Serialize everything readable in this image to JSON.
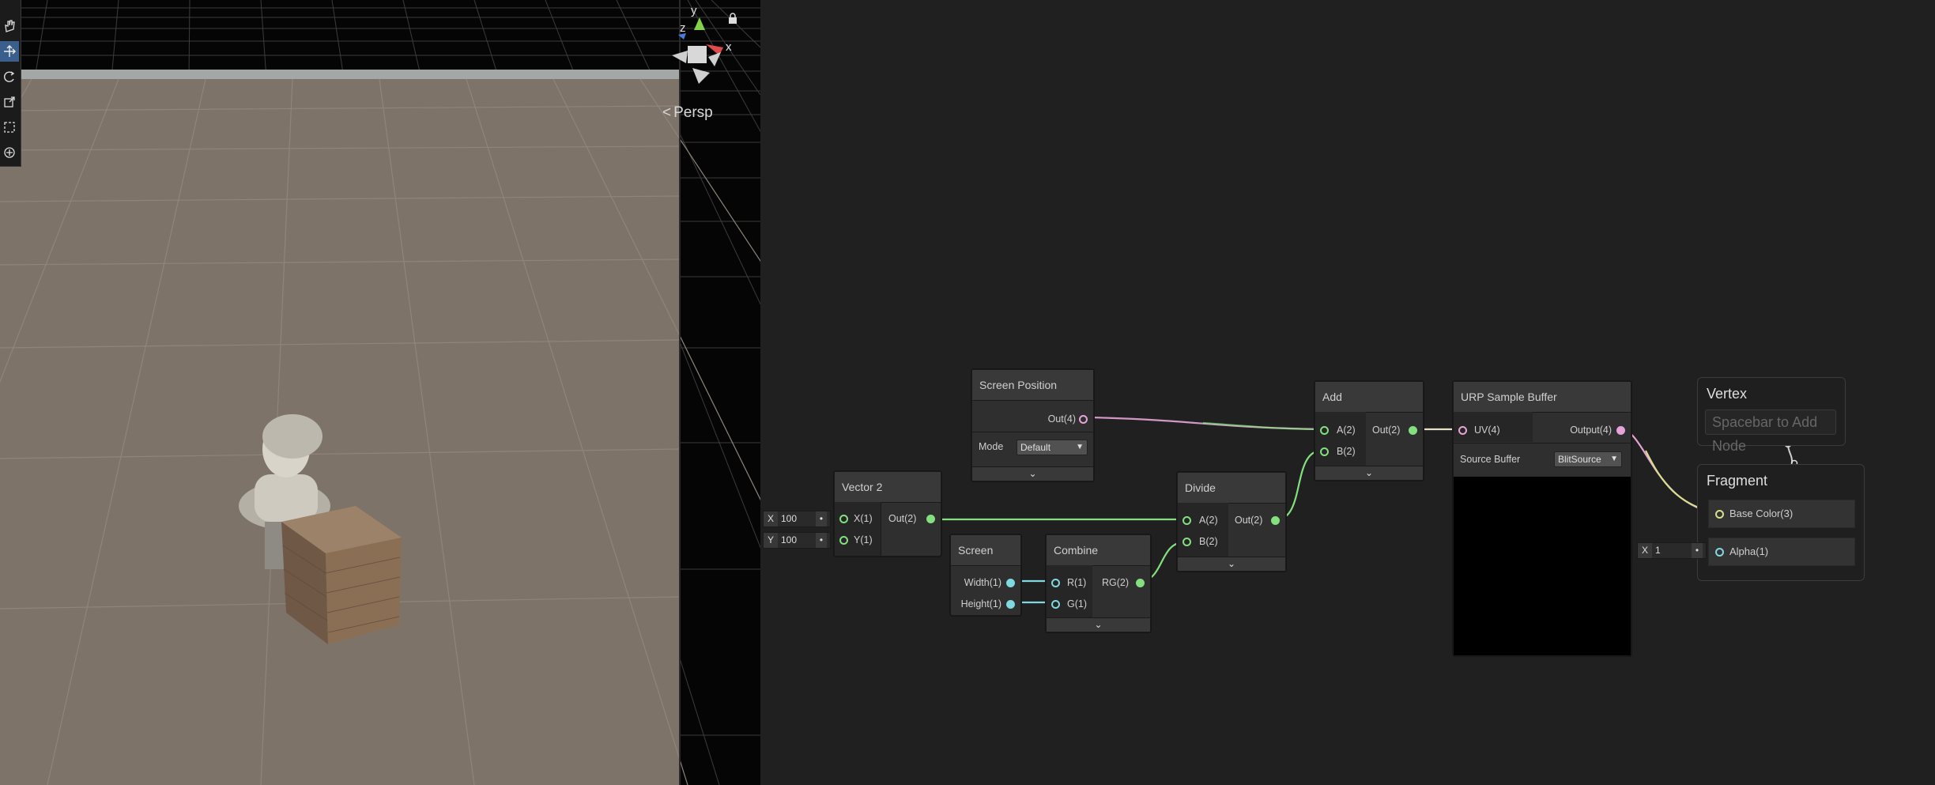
{
  "scene": {
    "view_mode": "Persp",
    "gizmo_axes": {
      "x": "x",
      "y": "y",
      "z": "z"
    },
    "tools": [
      "hand-tool",
      "move-tool",
      "rotate-tool",
      "scale-tool",
      "rect-tool",
      "transform-tool"
    ],
    "active_tool": "move-tool"
  },
  "graph": {
    "wire_colors": {
      "vector": "#84e07f",
      "color4": "#e7a4d8",
      "float": "#80d8e0"
    },
    "nodes": {
      "screen_position": {
        "title": "Screen Position",
        "out": "Out(4)",
        "mode_label": "Mode",
        "mode_value": "Default"
      },
      "vector2": {
        "title": "Vector 2",
        "x_in": "X(1)",
        "y_in": "Y(1)",
        "out": "Out(2)",
        "x_field_label": "X",
        "x_field_value": "100",
        "y_field_label": "Y",
        "y_field_value": "100"
      },
      "screen": {
        "title": "Screen",
        "width": "Width(1)",
        "height": "Height(1)"
      },
      "combine": {
        "title": "Combine",
        "r": "R(1)",
        "g": "G(1)",
        "out": "RG(2)"
      },
      "divide": {
        "title": "Divide",
        "a": "A(2)",
        "b": "B(2)",
        "out": "Out(2)"
      },
      "add": {
        "title": "Add",
        "a": "A(2)",
        "b": "B(2)",
        "out": "Out(2)"
      },
      "urp_sample_buffer": {
        "title": "URP Sample Buffer",
        "uv": "UV(4)",
        "out": "Output(4)",
        "source_label": "Source Buffer",
        "source_value": "BlitSource"
      }
    },
    "vertex": {
      "title": "Vertex",
      "placeholder": "Spacebar to Add Node"
    },
    "fragment": {
      "title": "Fragment",
      "base_color": "Base Color(3)",
      "alpha": "Alpha(1)",
      "alpha_field_label": "X",
      "alpha_field_value": "1"
    }
  }
}
